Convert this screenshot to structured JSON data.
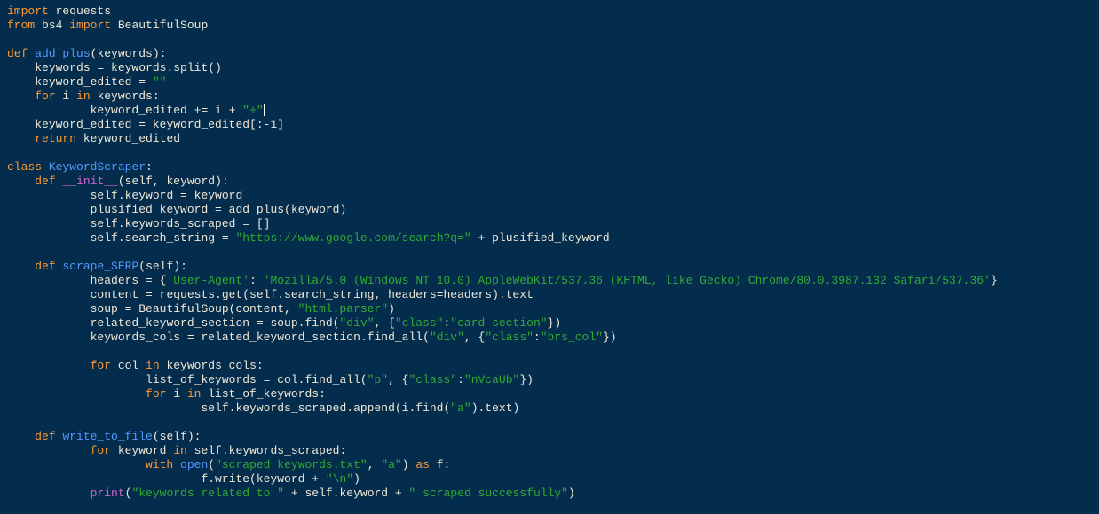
{
  "code": {
    "lines": [
      {
        "indent": 0,
        "tokens": [
          [
            "kw",
            "import"
          ],
          [
            "id",
            " requests"
          ]
        ]
      },
      {
        "indent": 0,
        "tokens": [
          [
            "kw",
            "from"
          ],
          [
            "id",
            " bs4 "
          ],
          [
            "kw",
            "import"
          ],
          [
            "id",
            " BeautifulSoup"
          ]
        ]
      },
      {
        "indent": 0,
        "tokens": []
      },
      {
        "indent": 0,
        "tokens": [
          [
            "kw",
            "def "
          ],
          [
            "fn",
            "add_plus"
          ],
          [
            "id",
            "(keywords):"
          ]
        ]
      },
      {
        "indent": 1,
        "tokens": [
          [
            "id",
            "keywords = keywords.split()"
          ]
        ]
      },
      {
        "indent": 1,
        "tokens": [
          [
            "id",
            "keyword_edited = "
          ],
          [
            "str",
            "\"\""
          ]
        ]
      },
      {
        "indent": 1,
        "tokens": [
          [
            "kw",
            "for"
          ],
          [
            "id",
            " i "
          ],
          [
            "kw",
            "in"
          ],
          [
            "id",
            " keywords:"
          ]
        ]
      },
      {
        "indent": 3,
        "tokens": [
          [
            "id",
            "keyword_edited += i + "
          ],
          [
            "str",
            "\"+\""
          ]
        ],
        "cursor": true
      },
      {
        "indent": 1,
        "tokens": [
          [
            "id",
            "keyword_edited = keyword_edited[:"
          ],
          [
            "num",
            "-1"
          ],
          [
            "id",
            "]"
          ]
        ]
      },
      {
        "indent": 1,
        "tokens": [
          [
            "kw",
            "return"
          ],
          [
            "id",
            " keyword_edited"
          ]
        ]
      },
      {
        "indent": 0,
        "tokens": []
      },
      {
        "indent": 0,
        "tokens": [
          [
            "kw",
            "class "
          ],
          [
            "fn",
            "KeywordScraper"
          ],
          [
            "id",
            ":"
          ]
        ]
      },
      {
        "indent": 1,
        "tokens": [
          [
            "kw",
            "def "
          ],
          [
            "dun",
            "__init__"
          ],
          [
            "id",
            "(self, keyword):"
          ]
        ]
      },
      {
        "indent": 3,
        "tokens": [
          [
            "id",
            "self.keyword = keyword"
          ]
        ]
      },
      {
        "indent": 3,
        "tokens": [
          [
            "id",
            "plusified_keyword = add_plus(keyword)"
          ]
        ]
      },
      {
        "indent": 3,
        "tokens": [
          [
            "id",
            "self.keywords_scraped = []"
          ]
        ]
      },
      {
        "indent": 3,
        "tokens": [
          [
            "id",
            "self.search_string = "
          ],
          [
            "str",
            "\"https://www.google.com/search?q=\""
          ],
          [
            "id",
            " + plusified_keyword"
          ]
        ]
      },
      {
        "indent": 0,
        "tokens": []
      },
      {
        "indent": 1,
        "tokens": [
          [
            "kw",
            "def "
          ],
          [
            "fn",
            "scrape_SERP"
          ],
          [
            "id",
            "(self):"
          ]
        ]
      },
      {
        "indent": 3,
        "tokens": [
          [
            "id",
            "headers = {"
          ],
          [
            "str",
            "'User-Agent'"
          ],
          [
            "id",
            ": "
          ],
          [
            "str",
            "'Mozilla/5.0 (Windows NT 10.0) AppleWebKit/537.36 (KHTML, like Gecko) Chrome/80.0.3987.132 Safari/537.36'"
          ],
          [
            "id",
            "}"
          ]
        ]
      },
      {
        "indent": 3,
        "tokens": [
          [
            "id",
            "content = requests.get(self.search_string, headers=headers).text"
          ]
        ]
      },
      {
        "indent": 3,
        "tokens": [
          [
            "id",
            "soup = BeautifulSoup(content, "
          ],
          [
            "str",
            "\"html.parser\""
          ],
          [
            "id",
            ")"
          ]
        ]
      },
      {
        "indent": 3,
        "tokens": [
          [
            "id",
            "related_keyword_section = soup.find("
          ],
          [
            "str",
            "\"div\""
          ],
          [
            "id",
            ", {"
          ],
          [
            "str",
            "\"class\""
          ],
          [
            "id",
            ":"
          ],
          [
            "str",
            "\"card-section\""
          ],
          [
            "id",
            "})"
          ]
        ]
      },
      {
        "indent": 3,
        "tokens": [
          [
            "id",
            "keywords_cols = related_keyword_section.find_all("
          ],
          [
            "str",
            "\"div\""
          ],
          [
            "id",
            ", {"
          ],
          [
            "str",
            "\"class\""
          ],
          [
            "id",
            ":"
          ],
          [
            "str",
            "\"brs_col\""
          ],
          [
            "id",
            "})"
          ]
        ]
      },
      {
        "indent": 0,
        "tokens": []
      },
      {
        "indent": 3,
        "tokens": [
          [
            "kw",
            "for"
          ],
          [
            "id",
            " col "
          ],
          [
            "kw",
            "in"
          ],
          [
            "id",
            " keywords_cols:"
          ]
        ]
      },
      {
        "indent": 5,
        "tokens": [
          [
            "id",
            "list_of_keywords = col.find_all("
          ],
          [
            "str",
            "\"p\""
          ],
          [
            "id",
            ", {"
          ],
          [
            "str",
            "\"class\""
          ],
          [
            "id",
            ":"
          ],
          [
            "str",
            "\"nVcaUb\""
          ],
          [
            "id",
            "})"
          ]
        ]
      },
      {
        "indent": 5,
        "tokens": [
          [
            "kw",
            "for"
          ],
          [
            "id",
            " i "
          ],
          [
            "kw",
            "in"
          ],
          [
            "id",
            " list_of_keywords:"
          ]
        ]
      },
      {
        "indent": 7,
        "tokens": [
          [
            "id",
            "self.keywords_scraped.append(i.find("
          ],
          [
            "str",
            "\"a\""
          ],
          [
            "id",
            ").text)"
          ]
        ]
      },
      {
        "indent": 0,
        "tokens": []
      },
      {
        "indent": 1,
        "tokens": [
          [
            "kw",
            "def "
          ],
          [
            "fn",
            "write_to_file"
          ],
          [
            "id",
            "(self):"
          ]
        ]
      },
      {
        "indent": 3,
        "tokens": [
          [
            "kw",
            "for"
          ],
          [
            "id",
            " keyword "
          ],
          [
            "kw",
            "in"
          ],
          [
            "id",
            " self.keywords_scraped:"
          ]
        ]
      },
      {
        "indent": 5,
        "tokens": [
          [
            "kw",
            "with "
          ],
          [
            "fn",
            "open"
          ],
          [
            "id",
            "("
          ],
          [
            "str",
            "\"scraped keywords.txt\""
          ],
          [
            "id",
            ", "
          ],
          [
            "str",
            "\"a\""
          ],
          [
            "id",
            ") "
          ],
          [
            "kw",
            "as"
          ],
          [
            "id",
            " f:"
          ]
        ]
      },
      {
        "indent": 7,
        "tokens": [
          [
            "id",
            "f.write(keyword + "
          ],
          [
            "str",
            "\"\\n\""
          ],
          [
            "id",
            ")"
          ]
        ]
      },
      {
        "indent": 3,
        "tokens": [
          [
            "dun",
            "print"
          ],
          [
            "id",
            "("
          ],
          [
            "str",
            "\"keywords related to \""
          ],
          [
            "id",
            " + self.keyword + "
          ],
          [
            "str",
            "\" scraped successfully\""
          ],
          [
            "id",
            ")"
          ]
        ]
      }
    ]
  },
  "indent_unit": "    ",
  "colors": {
    "background": "#042c4c",
    "keyword": "#ff9933",
    "function": "#5599ff",
    "string": "#33aa33",
    "dunder": "#cc66cc",
    "default": "#f0e8d8"
  }
}
